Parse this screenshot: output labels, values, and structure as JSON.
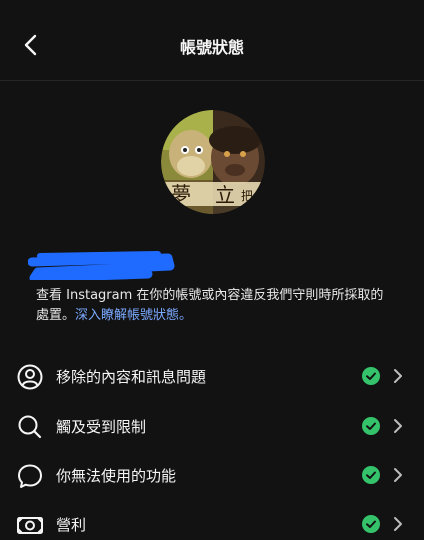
{
  "header": {
    "title": "帳號狀態"
  },
  "description": {
    "text": "查看 Instagram 在你的帳號或內容違反我們守則時所採取的處置。",
    "link": "深入瞭解帳號狀態。"
  },
  "items": [
    {
      "label": "移除的內容和訊息問題",
      "icon": "person-circle-icon"
    },
    {
      "label": "觸及受到限制",
      "icon": "search-icon"
    },
    {
      "label": "你無法使用的功能",
      "icon": "chat-bubble-icon"
    },
    {
      "label": "營利",
      "icon": "money-icon"
    }
  ],
  "colors": {
    "background": "#121212",
    "status_ok": "#34c26a",
    "link": "#7aa9ff",
    "redaction": "#1f6bff"
  }
}
